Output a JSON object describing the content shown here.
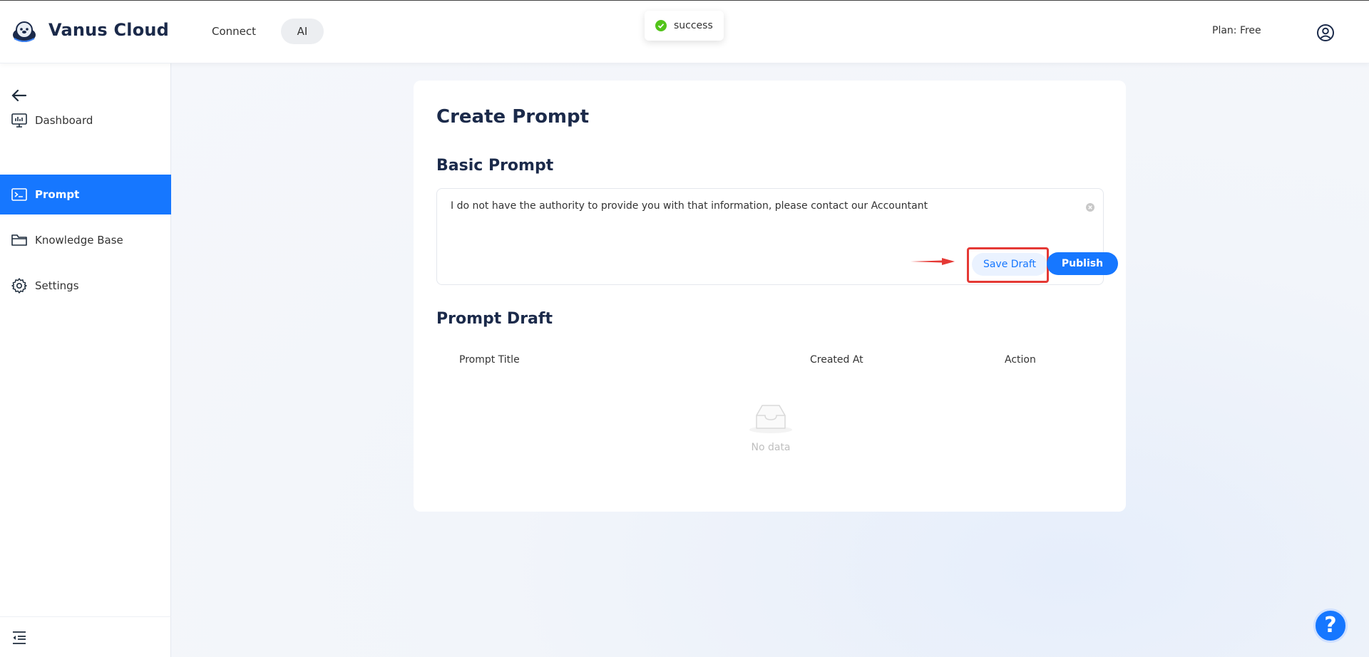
{
  "header": {
    "brand": "Vanus Cloud",
    "nav": [
      {
        "label": "Connect"
      },
      {
        "label": "AI"
      }
    ],
    "plan": "Plan: Free",
    "logo_icon": "otter-logo-icon",
    "user_icon": "user-circle-icon"
  },
  "toast": {
    "text": "success",
    "icon": "check-circle-icon",
    "color": "#52c41a"
  },
  "sidebar": {
    "back_icon": "arrow-left-icon",
    "items": [
      {
        "label": "Dashboard",
        "icon": "monitor-chart-icon"
      },
      {
        "label": "Prompt",
        "icon": "terminal-icon",
        "active": true
      },
      {
        "label": "Knowledge Base",
        "icon": "folder-icon"
      },
      {
        "label": "Settings",
        "icon": "gear-icon"
      }
    ],
    "collapse_icon": "menu-fold-icon"
  },
  "main": {
    "title": "Create Prompt",
    "basic_prompt": {
      "heading": "Basic Prompt",
      "value": "I do not have the authority to provide you with that information, please contact our Accountant",
      "save_label": "Save Draft",
      "publish_label": "Publish"
    },
    "draft": {
      "heading": "Prompt Draft",
      "columns": [
        "Prompt Title",
        "Created At",
        "Action"
      ],
      "empty_text": "No data"
    }
  },
  "help": {
    "label": "?"
  },
  "colors": {
    "accent": "#1677ff",
    "highlight": "#e53935",
    "success": "#52c41a"
  }
}
